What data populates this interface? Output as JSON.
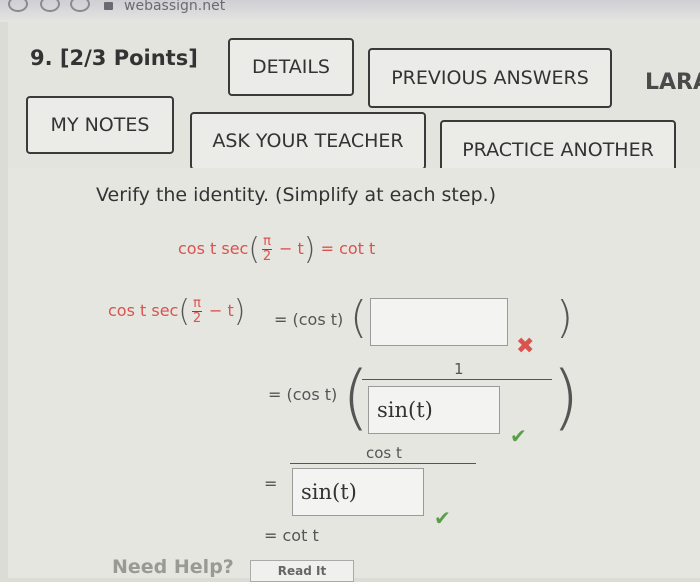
{
  "browser": {
    "url": "webassign.net"
  },
  "question": {
    "label": "9. [2/3 Points]",
    "buttons": {
      "details": "DETAILS",
      "previous_answers": "PREVIOUS ANSWERS",
      "lara_cut": "LARA",
      "my_notes": "MY NOTES",
      "ask_teacher": "ASK YOUR TEACHER",
      "practice_another": "PRACTICE ANOTHER"
    },
    "instruction": "Verify the identity. (Simplify at each step.)"
  },
  "identity": {
    "lhs_prefix": "cos t sec",
    "pi": "π",
    "two": "2",
    "minus_t": "− t",
    "equals": "=",
    "rhs": "cot t"
  },
  "steps": {
    "step1_lhs_prefix": "cos t sec",
    "step1_rhs": "= (cos t)",
    "step1_input_value": "",
    "step2_rhs": "= (cos t)",
    "step2_numerator": "1",
    "step2_input_value": "sin(t)",
    "step3_eq": "=",
    "step3_numerator": "cos t",
    "step3_input_value": "sin(t)",
    "step4": "= cot t"
  },
  "footer": {
    "need_help": "Need Help?",
    "read_it": "Read It"
  },
  "colors": {
    "correct": "#5a9e4a",
    "incorrect": "#d9534f",
    "identity_text": "#d9534f"
  }
}
